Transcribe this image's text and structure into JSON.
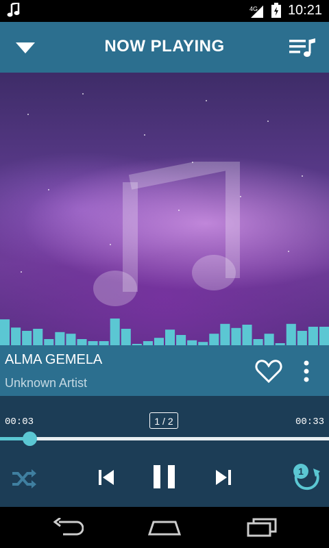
{
  "status_bar": {
    "time": "10:21",
    "network": "4G",
    "icons": [
      "music-note-icon",
      "signal-icon",
      "battery-icon"
    ]
  },
  "header": {
    "title": "NOW PLAYING",
    "left_icon": "chevron-down-icon",
    "right_icon": "queue-music-icon"
  },
  "artwork": {
    "icon": "music-note-icon",
    "equalizer_levels": [
      0.63,
      0.43,
      0.35,
      0.4,
      0.15,
      0.32,
      0.28,
      0.15,
      0.1,
      0.1,
      0.65,
      0.4,
      0.02,
      0.1,
      0.18,
      0.38,
      0.25,
      0.12,
      0.08,
      0.28,
      0.52,
      0.42,
      0.5,
      0.15,
      0.28,
      0.05,
      0.52,
      0.35,
      0.45,
      0.45
    ]
  },
  "track": {
    "title": "ALMA GEMELA",
    "artist": "Unknown Artist"
  },
  "player": {
    "elapsed": "00:03",
    "duration": "00:33",
    "queue_position": "1 / 2",
    "progress_fraction": 0.09,
    "repeat_badge": "1"
  },
  "colors": {
    "header": "#2c6f8f",
    "player": "#1c3d56",
    "accent": "#5bc7d3"
  }
}
